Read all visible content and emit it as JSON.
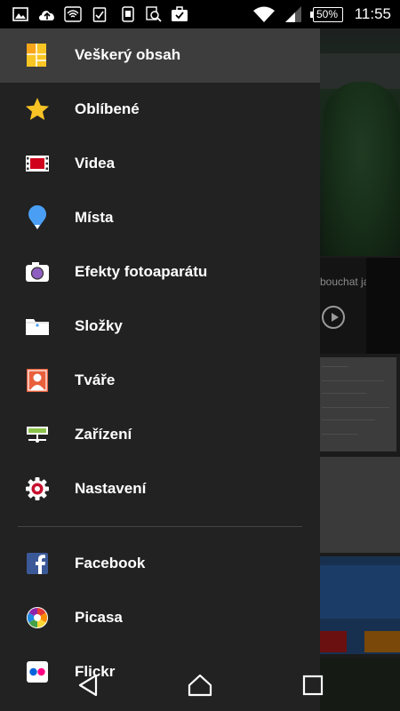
{
  "status_bar": {
    "time": "11:55",
    "battery": "50%",
    "icons": [
      "image-icon",
      "cloud-upload-icon",
      "wifi-badge-icon",
      "clipboard-check-icon",
      "phone-sync-icon",
      "search-doc-icon",
      "briefcase-check-icon",
      "wifi-icon",
      "signal-icon",
      "battery-icon"
    ]
  },
  "drawer": {
    "items": [
      {
        "label": "Veškerý obsah",
        "icon": "all-content-icon"
      },
      {
        "label": "Oblíbené",
        "icon": "star-icon"
      },
      {
        "label": "Videa",
        "icon": "film-icon"
      },
      {
        "label": "Místa",
        "icon": "map-pin-icon"
      },
      {
        "label": "Efekty fotoaparátu",
        "icon": "camera-icon"
      },
      {
        "label": "Složky",
        "icon": "folder-icon"
      },
      {
        "label": "Tváře",
        "icon": "face-portrait-icon"
      },
      {
        "label": "Zařízení",
        "icon": "devices-icon"
      },
      {
        "label": "Nastavení",
        "icon": "settings-gear-icon"
      },
      {
        "label": "Facebook",
        "icon": "facebook-icon"
      },
      {
        "label": "Picasa",
        "icon": "picasa-icon"
      },
      {
        "label": "Flickr",
        "icon": "flickr-icon"
      }
    ]
  },
  "background": {
    "video_title_fragment": "bouchat jako další"
  },
  "colors": {
    "drawer_bg": "#222222",
    "active_item_bg": "#3d3d3d",
    "star": "#f7c325",
    "film": "#d0021b",
    "pin": "#4a9ff5",
    "camera_lens": "#8e5fc0",
    "face": "#e8603c",
    "devices": "#8bc34a",
    "gear": "#c8102e",
    "facebook": "#3b5998"
  }
}
